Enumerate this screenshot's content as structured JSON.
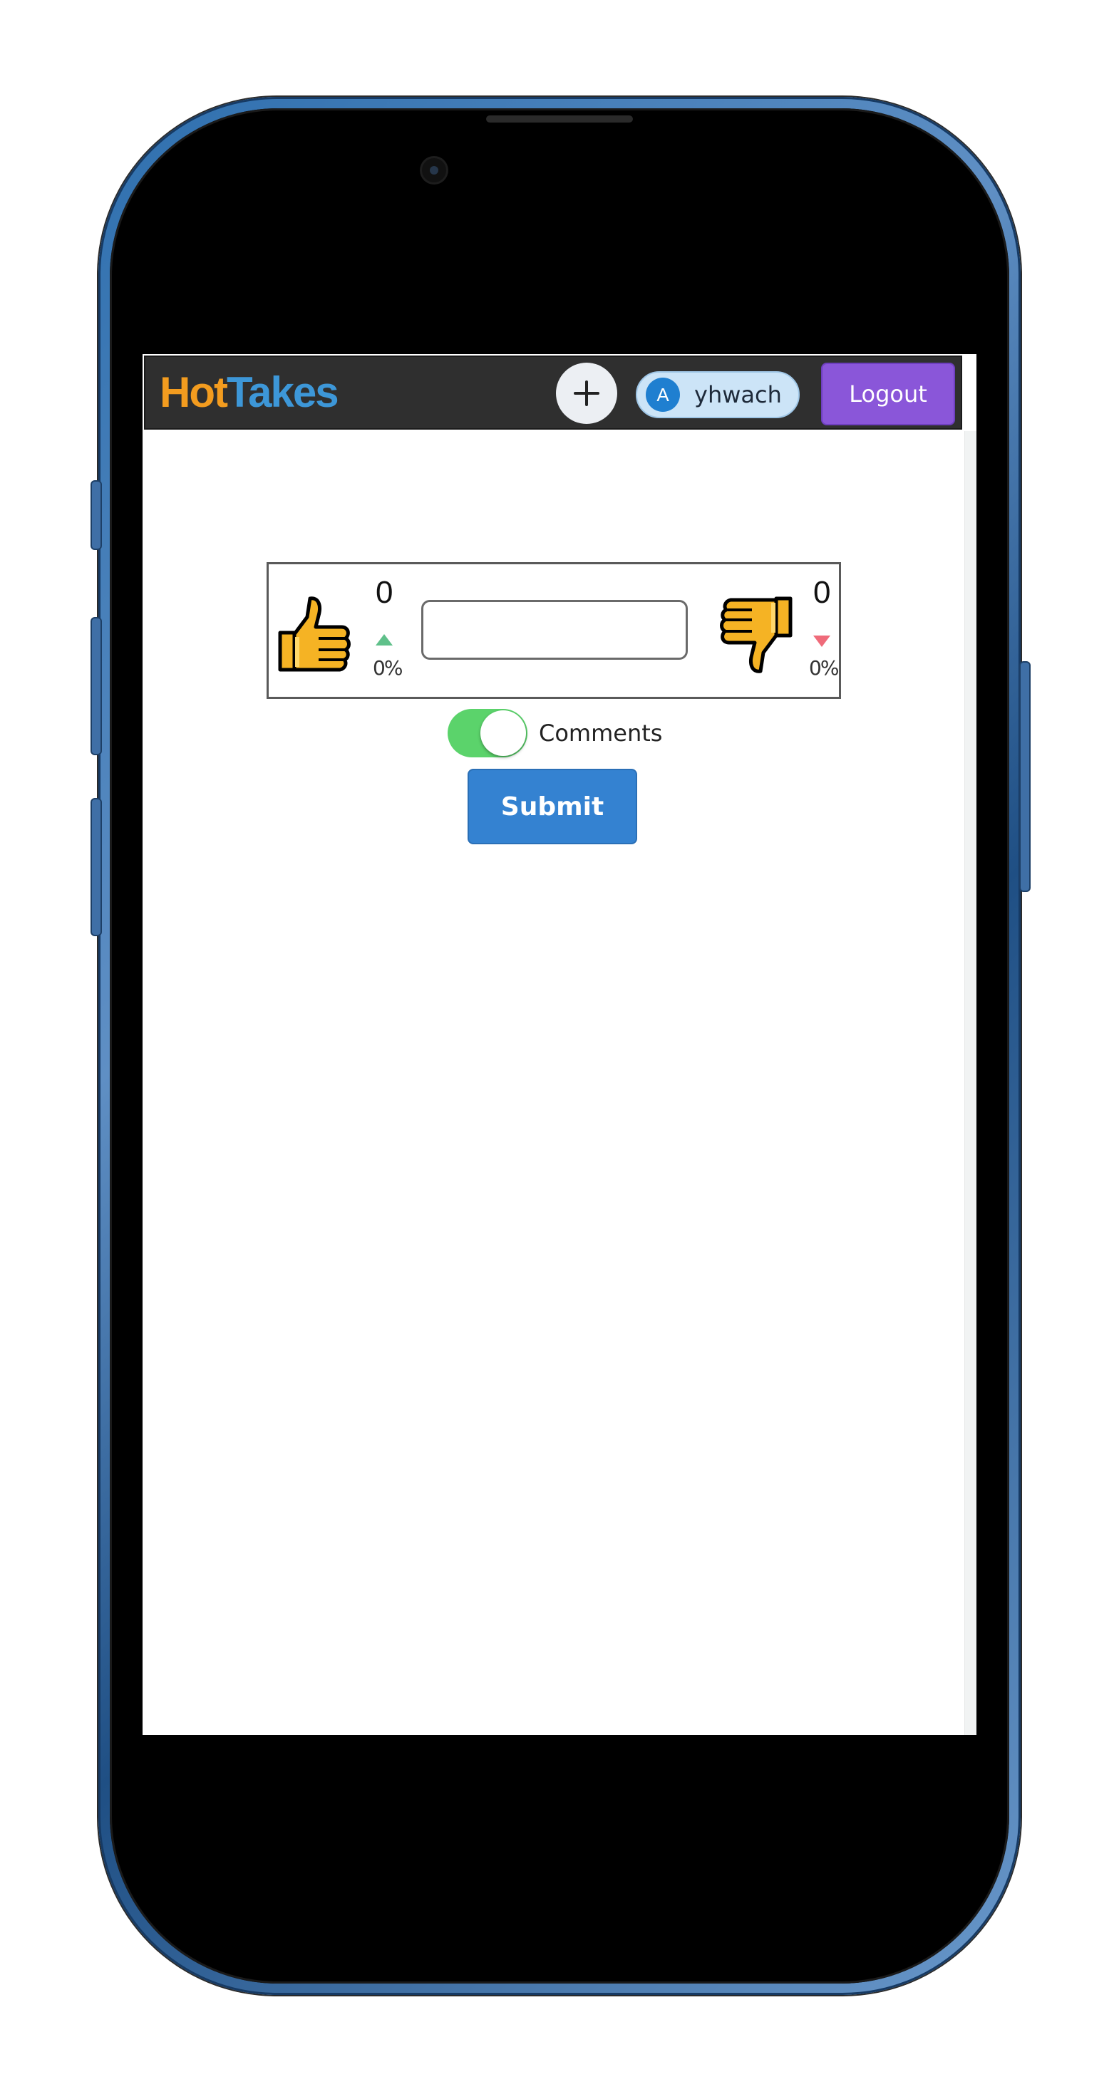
{
  "app": {
    "brand_hot": "Hot",
    "brand_takes": "Takes"
  },
  "header": {
    "add_icon": "plus-icon",
    "user": {
      "avatar_initial": "A",
      "username": "yhwach"
    },
    "logout_label": "Logout"
  },
  "vote_card": {
    "upvote": {
      "icon": "thumbs-up-icon",
      "count": "0",
      "percent": "0%"
    },
    "downvote": {
      "icon": "thumbs-down-icon",
      "count": "0",
      "percent": "0%"
    },
    "take_input": {
      "value": "",
      "placeholder": ""
    }
  },
  "comments_toggle": {
    "label": "Comments",
    "enabled": true
  },
  "submit_label": "Submit",
  "colors": {
    "brand_hot": "#f39c1f",
    "brand_takes": "#3d97d8",
    "header_bg": "#2f2f2f",
    "logout_bg": "#8a56d9",
    "submit_bg": "#3482d1",
    "toggle_on": "#5bd36b",
    "up_arrow": "#5fc08a",
    "down_arrow": "#ef6b7a"
  }
}
